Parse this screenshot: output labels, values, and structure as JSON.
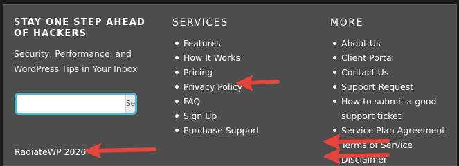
{
  "newsletter": {
    "heading": "STAY ONE STEP AHEAD OF HACKERS",
    "tagline": "Security, Performance, and WordPress Tips in Your Inbox",
    "search_placeholder": "",
    "search_button": "Search",
    "copyright": "RadiateWP 2020"
  },
  "services": {
    "heading": "SERVICES",
    "items": [
      "Features",
      "How It Works",
      "Pricing",
      "Privacy Policy",
      "FAQ",
      "Sign Up",
      "Purchase Support"
    ]
  },
  "more": {
    "heading": "MORE",
    "items": [
      "About Us",
      "Client Portal",
      "Contact Us",
      "Support Request",
      "How to submit a good support ticket",
      "Service Plan Agreement",
      "Terms of Service",
      "Disclaimer"
    ]
  },
  "annotations": {
    "arrow_color": "#e5453d",
    "arrow_icon": "arrow-left-icon",
    "targets": [
      "Privacy Policy",
      "RadiateWP 2020",
      "Terms of Service",
      "Disclaimer"
    ]
  }
}
